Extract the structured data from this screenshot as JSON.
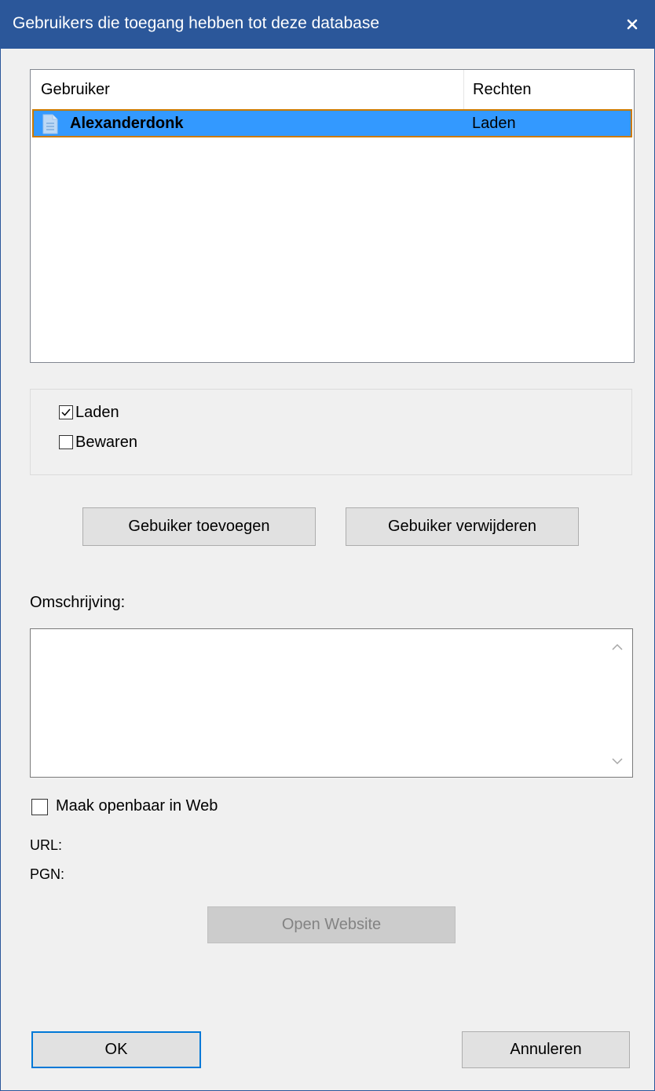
{
  "dialog": {
    "title": "Gebruikers die toegang hebben tot deze database",
    "close_icon": "close-icon"
  },
  "users_list": {
    "columns": [
      "Gebruiker",
      "Rechten"
    ],
    "rows": [
      {
        "user": "Alexanderdonk",
        "rights": "Laden",
        "icon": "database-file-icon",
        "selected": true
      }
    ]
  },
  "permissions": {
    "load": {
      "label": "Laden",
      "checked": true
    },
    "save": {
      "label": "Bewaren",
      "checked": false
    }
  },
  "buttons": {
    "add_user": "Gebuiker toevoegen",
    "remove_user": "Gebuiker verwijderen",
    "open_website": "Open Website",
    "ok": "OK",
    "cancel": "Annuleren"
  },
  "description": {
    "label": "Omschrijving:",
    "value": ""
  },
  "web": {
    "public_label": "Maak openbaar in Web",
    "public_checked": false,
    "url_label": "URL:",
    "pgn_label": "PGN:"
  },
  "colors": {
    "titlebar": "#2b579a",
    "selection": "#3399ff",
    "selection_border": "#cc7a00",
    "default_button_border": "#0078d7"
  }
}
